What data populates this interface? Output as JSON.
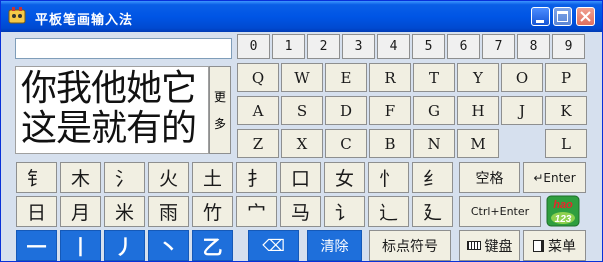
{
  "window": {
    "title": "平板笔画输入法"
  },
  "input": {
    "value": ""
  },
  "digits": [
    "0",
    "1",
    "2",
    "3",
    "4",
    "5",
    "6",
    "7",
    "8",
    "9"
  ],
  "letters_row1": [
    "Q",
    "W",
    "E",
    "R",
    "T",
    "Y",
    "O",
    "P"
  ],
  "letters_row2": [
    "A",
    "S",
    "D",
    "F",
    "G",
    "H",
    "J",
    "K"
  ],
  "letters_row3": [
    "Z",
    "X",
    "C",
    "B",
    "N",
    "M",
    "L"
  ],
  "candidates": {
    "line1": "你我他她它",
    "line2": "这是就有的",
    "more_top": "更",
    "more_bottom": "多"
  },
  "radicals_row1": [
    "钅",
    "木",
    "氵",
    "火",
    "土",
    "扌",
    "口",
    "女",
    "忄",
    "纟"
  ],
  "radicals_row2": [
    "日",
    "月",
    "米",
    "雨",
    "竹",
    "宀",
    "马",
    "讠",
    "辶",
    "廴"
  ],
  "strokes": [
    "一",
    "丨",
    "丿",
    "丶",
    "乙"
  ],
  "buttons": {
    "space": "空格",
    "enter": "↵Enter",
    "ctrl_enter": "Ctrl+Enter",
    "clear": "清除",
    "punct": "标点符号",
    "keyboard": "键盘",
    "menu": "菜单",
    "backspace": "⌫"
  },
  "logo": {
    "top": "hao",
    "bottom": "123"
  },
  "colors": {
    "title_bar": "#0055e5",
    "stroke_keys": "#1e6fdb",
    "key_face": "#f1efe2",
    "panel": "#d6e0ee"
  }
}
